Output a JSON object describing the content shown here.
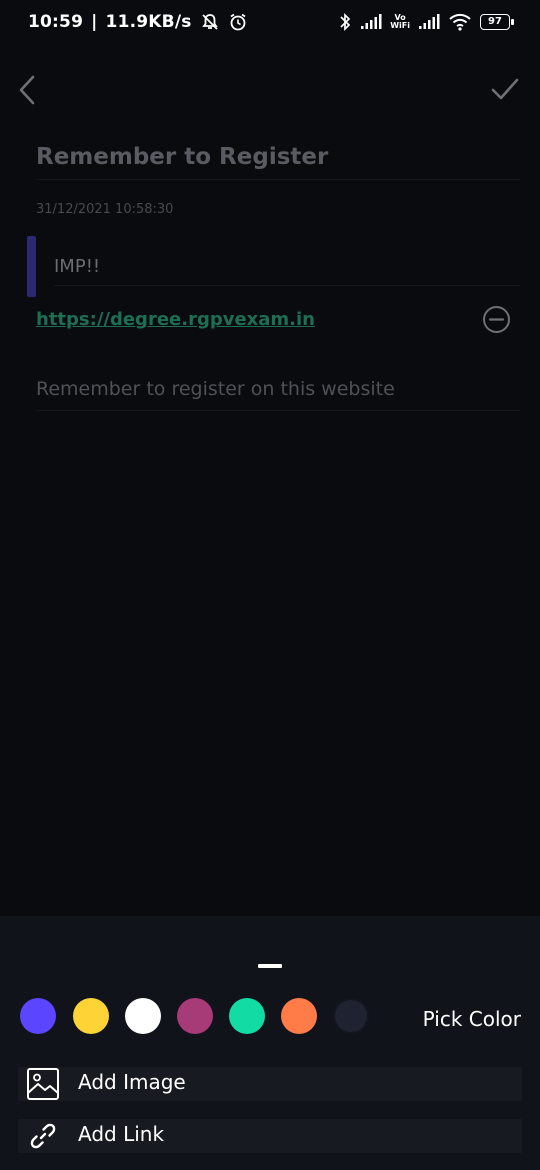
{
  "status_bar": {
    "time": "10:59",
    "separator": "|",
    "network_speed": "11.9KB/s",
    "vo_label": "Vo",
    "wifi_label": "WiFi",
    "battery": "97",
    "icons": [
      "mute-icon",
      "alarm-icon",
      "bluetooth-icon",
      "signal-icon",
      "wifi-icon",
      "battery-icon"
    ]
  },
  "toolbar": {
    "back_icon": "chevron-left-icon",
    "save_icon": "check-icon"
  },
  "note": {
    "title": "Remember to Register",
    "datetime": "31/12/2021 10:58:30",
    "subtitle": "IMP!!",
    "url": "https://degree.rgpvexam.in",
    "body": "Remember to register on this website",
    "indicator_color": "#2c2872"
  },
  "misc_sheet": {
    "colors": [
      {
        "name": "purple",
        "hex": "#5b45ff"
      },
      {
        "name": "yellow",
        "hex": "#fdd335"
      },
      {
        "name": "white",
        "hex": "#ffffff"
      },
      {
        "name": "magenta",
        "hex": "#a63b78"
      },
      {
        "name": "green",
        "hex": "#12dba3"
      },
      {
        "name": "orange",
        "hex": "#ff7b47"
      },
      {
        "name": "dark",
        "hex": "#1e2231"
      }
    ],
    "pick_color_label": "Pick Color",
    "add_image_label": "Add Image",
    "add_link_label": "Add Link"
  }
}
